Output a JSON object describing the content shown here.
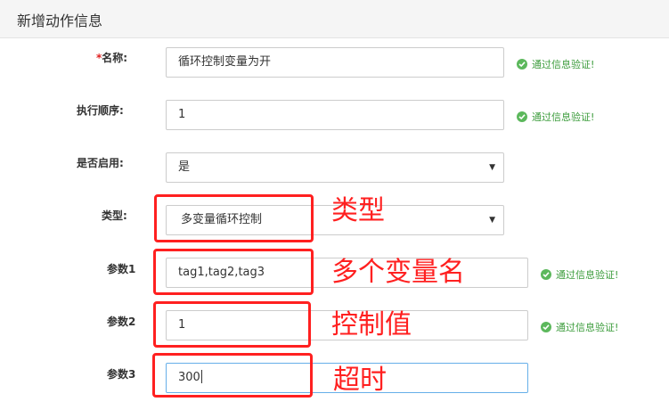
{
  "header": {
    "title": "新增动作信息"
  },
  "form": {
    "name": {
      "required_mark": "*",
      "label": "名称:",
      "value": "循环控制变量为开",
      "validation": "通过信息验证!"
    },
    "order": {
      "label": "执行顺序:",
      "value": "1",
      "validation": "通过信息验证!"
    },
    "enabled": {
      "label": "是否启用:",
      "value": "是"
    },
    "type": {
      "label": "类型:",
      "value": "多变量循环控制"
    },
    "param1": {
      "label": "参数1",
      "value": "tag1,tag2,tag3",
      "validation": "通过信息验证!"
    },
    "param2": {
      "label": "参数2",
      "value": "1",
      "validation": "通过信息验证!"
    },
    "param3": {
      "label": "参数3",
      "value": "300"
    }
  },
  "annotations": {
    "type": "类型",
    "param1": "多个变量名",
    "param2": "控制值",
    "param3": "超时"
  },
  "colors": {
    "annotation": "#ff2020",
    "success": "#3c9c3c",
    "required": "#e02020"
  },
  "icons": {
    "validation": "check-circle-icon",
    "select": "caret-down-icon"
  }
}
